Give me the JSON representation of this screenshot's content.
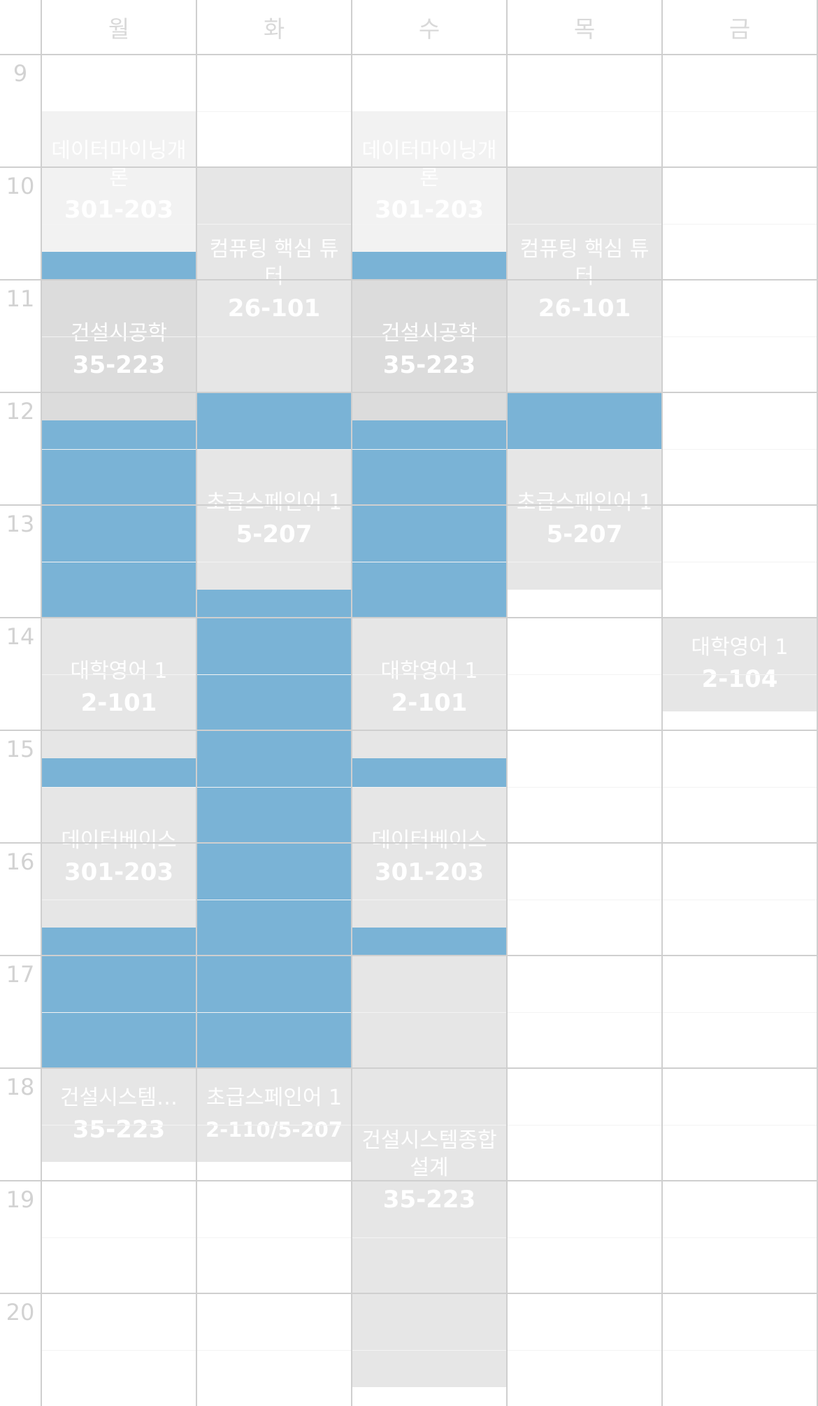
{
  "days": [
    "월",
    "화",
    "수",
    "목",
    "금"
  ],
  "hours": [
    "9",
    "10",
    "11",
    "12",
    "13",
    "14",
    "15",
    "16",
    "17",
    "18",
    "19",
    "20"
  ],
  "colors": {
    "free_time": "#7ab3d6",
    "class_light": "#f2f2f2",
    "class_mid": "#e6e6e6",
    "class_dark": "#dcdcdc",
    "grid": "#cfcfcf",
    "label_text": "#d2d2d2"
  },
  "classes": [
    {
      "id": "datamining-mon",
      "day": 0,
      "start": 9.5,
      "end": 10.75,
      "title": "데이터마이닝개론",
      "room": "301-203",
      "shade": "light"
    },
    {
      "id": "datamining-wed",
      "day": 2,
      "start": 9.5,
      "end": 10.75,
      "title": "데이터마이닝개론",
      "room": "301-203",
      "shade": "light"
    },
    {
      "id": "computing-tue",
      "day": 1,
      "start": 10.0,
      "end": 12.0,
      "title": "컴퓨팅 핵심 튜터",
      "room": "26-101",
      "shade": "mid"
    },
    {
      "id": "computing-thu",
      "day": 3,
      "start": 10.0,
      "end": 12.0,
      "title": "컴퓨팅 핵심 튜터",
      "room": "26-101",
      "shade": "mid"
    },
    {
      "id": "construction-mon",
      "day": 0,
      "start": 11.0,
      "end": 12.25,
      "title": "건설시공학",
      "room": "35-223",
      "shade": "dark"
    },
    {
      "id": "construction-wed",
      "day": 2,
      "start": 11.0,
      "end": 12.25,
      "title": "건설시공학",
      "room": "35-223",
      "shade": "dark"
    },
    {
      "id": "spanish-tue",
      "day": 1,
      "start": 12.5,
      "end": 13.75,
      "title": "초급스페인어 1",
      "room": "5-207",
      "shade": "mid"
    },
    {
      "id": "spanish-thu",
      "day": 3,
      "start": 12.5,
      "end": 13.75,
      "title": "초급스페인어 1",
      "room": "5-207",
      "shade": "mid"
    },
    {
      "id": "english-mon",
      "day": 0,
      "start": 14.0,
      "end": 15.25,
      "title": "대학영어 1",
      "room": "2-101",
      "shade": "mid"
    },
    {
      "id": "english-wed",
      "day": 2,
      "start": 14.0,
      "end": 15.25,
      "title": "대학영어 1",
      "room": "2-101",
      "shade": "mid"
    },
    {
      "id": "english-fri",
      "day": 4,
      "start": 14.0,
      "end": 14.83,
      "title": "대학영어 1",
      "room": "2-104",
      "shade": "mid"
    },
    {
      "id": "database-mon",
      "day": 0,
      "start": 15.5,
      "end": 16.75,
      "title": "데이터베이스",
      "room": "301-203",
      "shade": "mid"
    },
    {
      "id": "database-wed",
      "day": 2,
      "start": 15.5,
      "end": 16.75,
      "title": "데이터베이스",
      "room": "301-203",
      "shade": "mid"
    },
    {
      "id": "constructsys-wed",
      "day": 2,
      "start": 17.0,
      "end": 20.83,
      "title": "건설시스템종합설계",
      "room": "35-223",
      "shade": "mid"
    },
    {
      "id": "constructsys-mon",
      "day": 0,
      "start": 18.0,
      "end": 18.83,
      "title": "건설시스템…",
      "room": "35-223",
      "shade": "mid"
    },
    {
      "id": "spanish2-tue",
      "day": 1,
      "start": 18.0,
      "end": 18.83,
      "title": "초급스페인어 1",
      "room": "2-110/5-207",
      "shade": "mid"
    }
  ],
  "free_blocks": [
    {
      "day": 0,
      "start": 10.75,
      "end": 11.0
    },
    {
      "day": 2,
      "start": 10.75,
      "end": 11.0
    },
    {
      "day": 0,
      "start": 12.25,
      "end": 14.0
    },
    {
      "day": 2,
      "start": 12.25,
      "end": 14.0
    },
    {
      "day": 1,
      "start": 12.0,
      "end": 12.5
    },
    {
      "day": 3,
      "start": 12.0,
      "end": 12.5
    },
    {
      "day": 1,
      "start": 13.75,
      "end": 18.0
    },
    {
      "day": 0,
      "start": 15.25,
      "end": 15.5
    },
    {
      "day": 2,
      "start": 15.25,
      "end": 15.5
    },
    {
      "day": 0,
      "start": 16.75,
      "end": 18.0
    },
    {
      "day": 2,
      "start": 16.75,
      "end": 17.0
    }
  ]
}
